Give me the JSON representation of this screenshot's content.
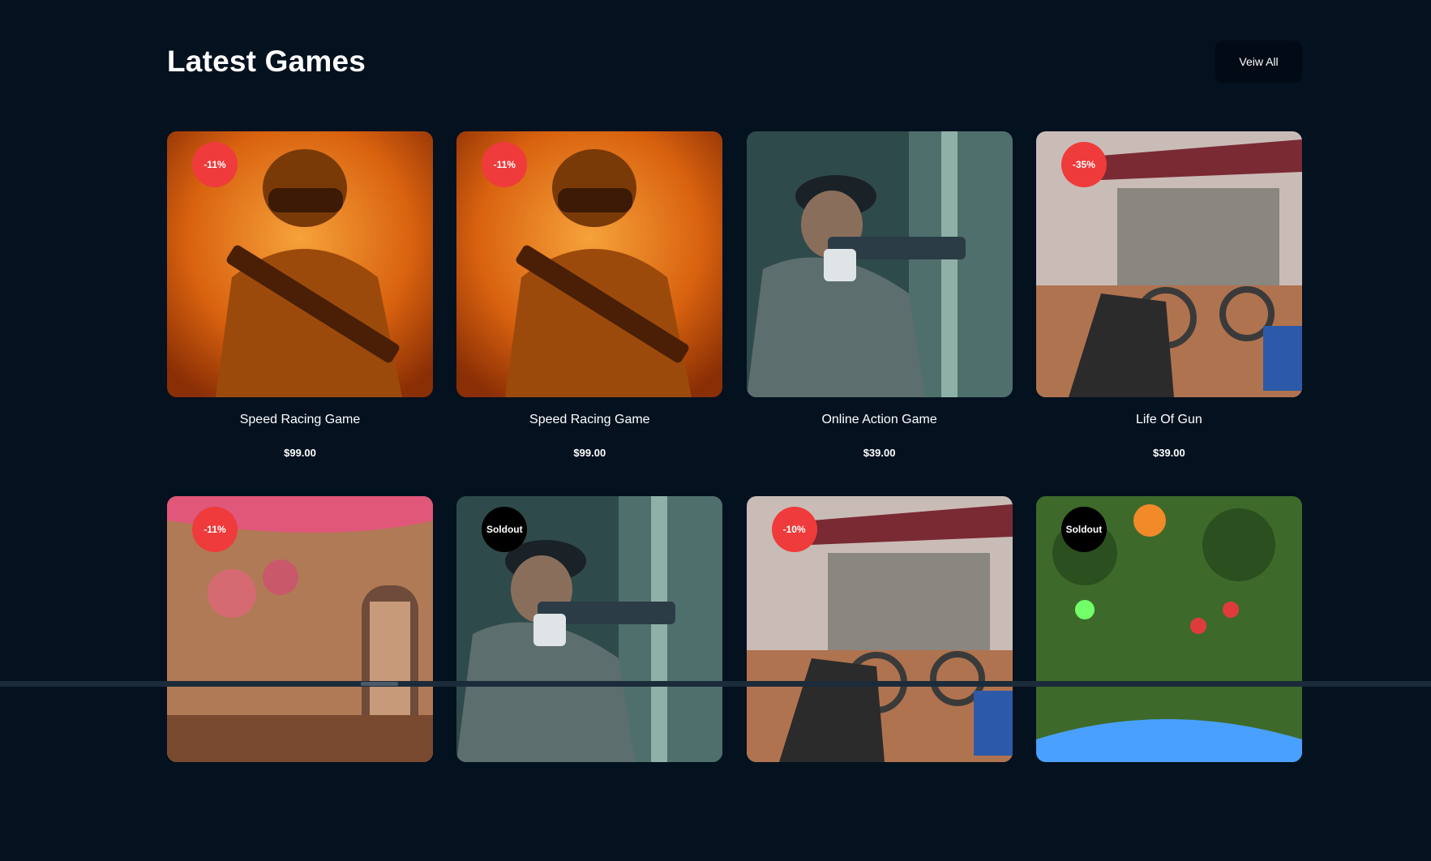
{
  "section": {
    "title": "Latest Games",
    "view_all_label": "Veiw All"
  },
  "products": [
    {
      "name": "Speed Racing Game",
      "price": "$99.00",
      "badge": "-11%",
      "badge_type": "sale",
      "art": "soldier-orange"
    },
    {
      "name": "Speed Racing Game",
      "price": "$99.00",
      "badge": "-11%",
      "badge_type": "sale",
      "art": "soldier-orange"
    },
    {
      "name": "Online Action Game",
      "price": "$39.00",
      "badge": "",
      "badge_type": "none",
      "art": "soldier-teal"
    },
    {
      "name": "Life Of Gun",
      "price": "$39.00",
      "badge": "-35%",
      "badge_type": "sale",
      "art": "battleground"
    },
    {
      "name": "",
      "price": "",
      "badge": "-11%",
      "badge_type": "sale",
      "art": "courtyard"
    },
    {
      "name": "",
      "price": "",
      "badge": "Soldout",
      "badge_type": "soldout",
      "art": "soldier-teal"
    },
    {
      "name": "",
      "price": "",
      "badge": "-10%",
      "badge_type": "sale",
      "art": "battleground"
    },
    {
      "name": "",
      "price": "",
      "badge": "Soldout",
      "badge_type": "soldout",
      "art": "moba"
    }
  ],
  "colors": {
    "background": "#04111f",
    "sale_badge": "#ef3b3b",
    "soldout_badge": "#000000"
  }
}
